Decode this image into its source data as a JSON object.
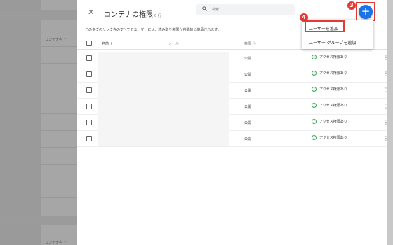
{
  "background_app": {
    "column_label_top": "コンテナ名 ↑",
    "column_label_bottom": "コンテナ名 ↑"
  },
  "dialog": {
    "title": "コンテナの権限",
    "title_count": "6 行",
    "search_placeholder": "検索",
    "add_icon": "plus-icon",
    "description": "このタグのリンク先のすべてのユーザーには、読み取り権限が自動的に継承されます。"
  },
  "table": {
    "headers": {
      "name": "名前 ↑",
      "email": "メール",
      "permission": "権限 ⓘ"
    },
    "rows": [
      {
        "permission": "公開",
        "access": "アクセス権限あり"
      },
      {
        "permission": "公開",
        "access": "アクセス権限あり"
      },
      {
        "permission": "公開",
        "access": "アクセス権限あり"
      },
      {
        "permission": "公開",
        "access": "アクセス権限あり"
      },
      {
        "permission": "公開",
        "access": "アクセス権限あり"
      },
      {
        "permission": "公開",
        "access": "アクセス権限あり"
      }
    ]
  },
  "menu": {
    "items": [
      "ユーザーを追加",
      "ユーザー グループを追加"
    ]
  },
  "annotations": {
    "badge_3": "3",
    "badge_4": "4"
  },
  "colors": {
    "accent": "#1a73e8",
    "annotation": "#e53935",
    "success": "#34a853"
  }
}
